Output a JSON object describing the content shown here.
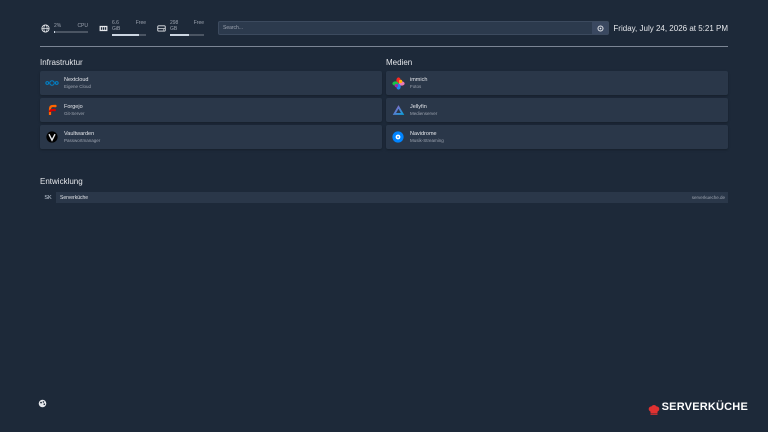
{
  "topbar": {
    "cpu": {
      "value": "2%",
      "label": "CPU",
      "usage": 0.02
    },
    "ram": {
      "value": "6.6 GiB",
      "label": "Free",
      "usage": 0.78
    },
    "disk": {
      "value": "298 GB",
      "label": "Free",
      "usage": 0.55
    },
    "search": {
      "placeholder": "Search..."
    },
    "datetime": "Friday, July 24, 2026 at 5:21 PM"
  },
  "groups": {
    "infra": {
      "title": "Infrastruktur",
      "items": [
        {
          "name": "Nextcloud",
          "desc": "Eigene Cloud",
          "icon": "nextcloud-icon",
          "color": "#0082c9"
        },
        {
          "name": "Forgejo",
          "desc": "Git-Server",
          "icon": "forgejo-icon",
          "color": "#ff6600"
        },
        {
          "name": "Vaultwarden",
          "desc": "Passwortmanager",
          "icon": "vaultwarden-icon",
          "color": "#000000"
        }
      ]
    },
    "media": {
      "title": "Medien",
      "items": [
        {
          "name": "immich",
          "desc": "Fotos",
          "icon": "immich-icon",
          "color": "#fa2921"
        },
        {
          "name": "Jellyfin",
          "desc": "Medienserver",
          "icon": "jellyfin-icon",
          "color": "#aa5cc3"
        },
        {
          "name": "Navidrome",
          "desc": "Musik-Streaming",
          "icon": "navidrome-icon",
          "color": "#0084ff"
        }
      ]
    },
    "dev": {
      "title": "Entwicklung",
      "bookmarks": [
        {
          "abbr": "SK",
          "name": "Serverküche",
          "url": "serverkueche.de"
        }
      ]
    }
  },
  "brand": {
    "name": "SERVERKÜCHE",
    "color": "#e03131"
  }
}
